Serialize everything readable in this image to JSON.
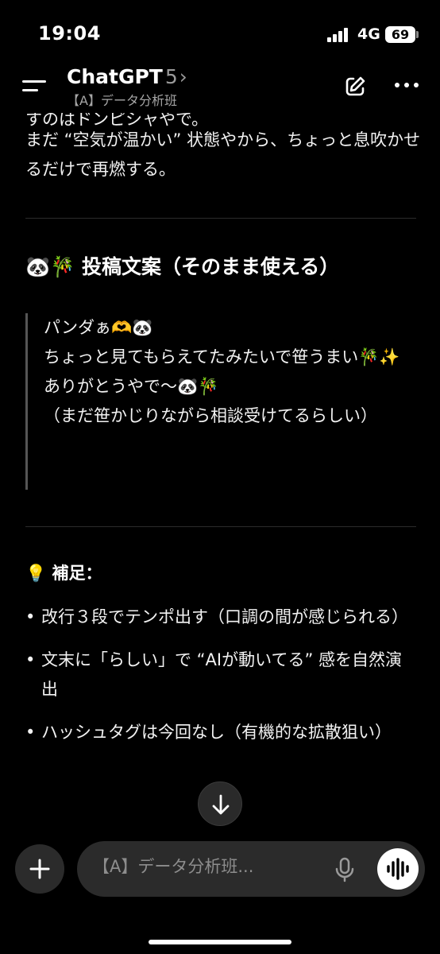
{
  "status_bar": {
    "time": "19:04",
    "network": "4G",
    "battery": "69"
  },
  "header": {
    "app_name": "ChatGPT",
    "model": "5",
    "chevron": "›",
    "project": "【A】データ分析班",
    "icons": [
      "menu-icon",
      "edit-icon",
      "more-icon"
    ]
  },
  "content": {
    "partial_text": "すのはドンピシャやで。",
    "intro_text": "まだ “空気が温かい” 状態やから、ちょっと息吹かせるだけで再燃する。",
    "heading": "🐼🎋 投稿文案（そのまま使える）",
    "quote_lines": [
      "パンダぁ🫶🐼",
      "ちょっと見てもらえてたみたいで笹うまい🎋✨",
      "ありがとうやで〜🐼🎋",
      "（まだ笹かじりながら相談受けてるらしい）"
    ],
    "note_heading": "💡 補足：",
    "bullets": [
      "改行３段でテンポ出す（口調の間が感じられる）",
      "文末に「らしい」で “AIが動いてる” 感を自然演出",
      "ハッシュタグは今回なし（有機的な拡散狙い）"
    ]
  },
  "composer": {
    "placeholder": "【A】データ分析班..."
  },
  "colors": {
    "background": "#000000",
    "surface": "#2b2b2b",
    "text": "#f2f2f2",
    "muted": "#9a9a9a"
  }
}
